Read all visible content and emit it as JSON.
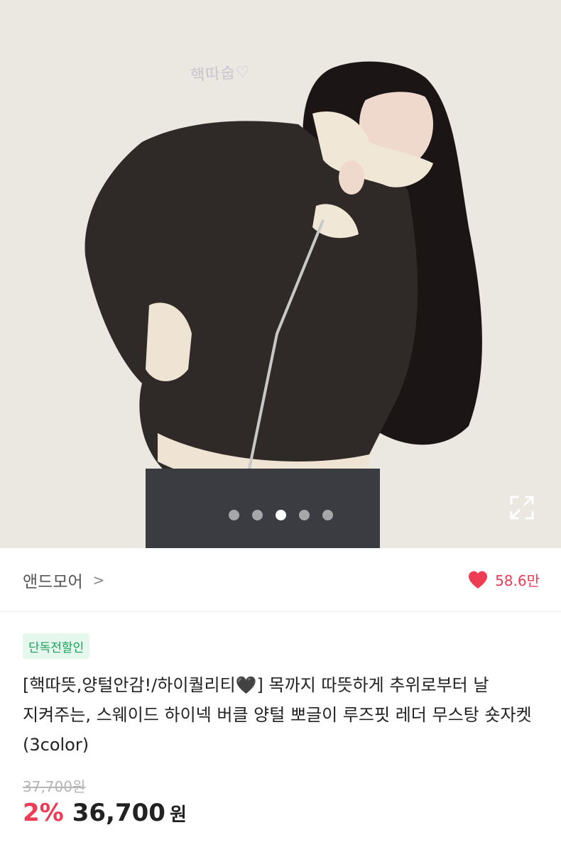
{
  "hero": {
    "handwriting": "핵따숩♡",
    "image_count": 5,
    "active_index": 2,
    "background": "#ebe7e1"
  },
  "store": {
    "name": "앤드모어",
    "chevron": ">"
  },
  "likes": {
    "count": "58.6만",
    "color": "#ee3c55"
  },
  "product": {
    "badge": "단독전할인",
    "title": "[핵따뜻,양털안감!/하이퀄리티🖤] 목까지 따뜻하게 추위로부터 날 지켜주는, 스웨이드 하이넥 버클 양털 뽀글이 루즈핏 레더 무스탕 숏자켓 (3color)",
    "original_price": "37,700원",
    "discount": "2%",
    "price": "36,700",
    "currency": "원"
  },
  "icons": {
    "expand": "expand-icon",
    "heart": "heart-icon",
    "chevron": "chevron-right-icon"
  },
  "colors": {
    "accent_red": "#ee3c55",
    "badge_green": "#1aa05a",
    "badge_bg": "#e6f7ee"
  }
}
